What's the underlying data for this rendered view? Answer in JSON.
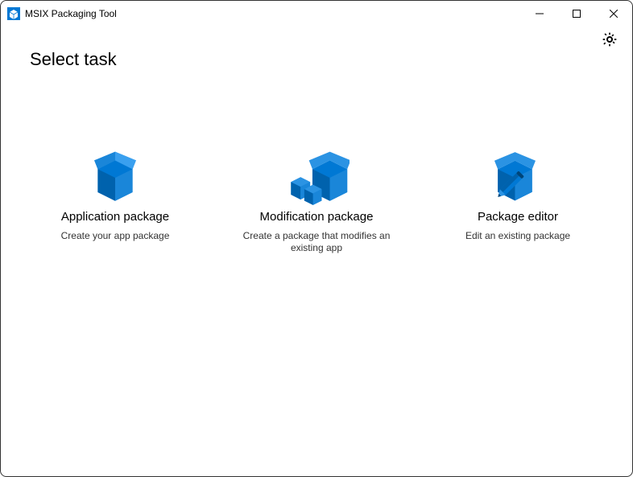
{
  "window": {
    "title": "MSIX Packaging Tool"
  },
  "colors": {
    "accent": "#0078D4"
  },
  "page": {
    "heading": "Select task"
  },
  "tasks": [
    {
      "title": "Application package",
      "description": "Create your app package"
    },
    {
      "title": "Modification package",
      "description": "Create a package that modifies an existing app"
    },
    {
      "title": "Package editor",
      "description": "Edit an existing package"
    }
  ]
}
